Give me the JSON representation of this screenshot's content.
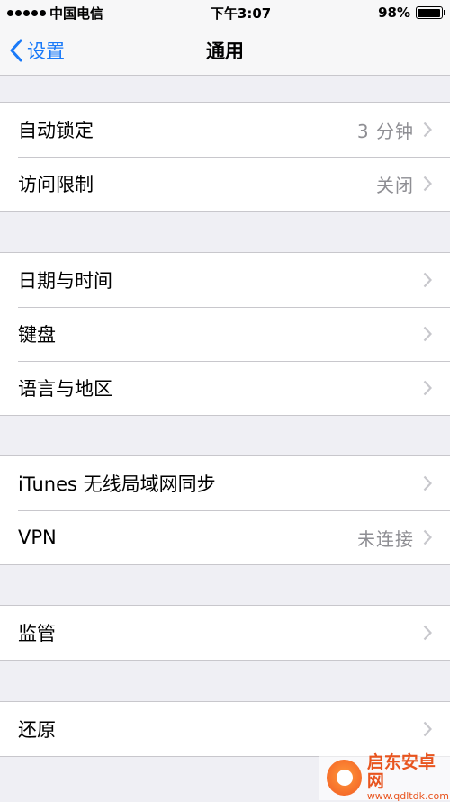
{
  "status": {
    "carrier": "中国电信",
    "time": "下午3:07",
    "battery": "98%",
    "battery_level": 0.98
  },
  "nav": {
    "back_label": "设置",
    "title": "通用"
  },
  "groups": [
    {
      "rows": [
        {
          "label": "自动锁定",
          "value": "3 分钟"
        },
        {
          "label": "访问限制",
          "value": "关闭"
        }
      ]
    },
    {
      "rows": [
        {
          "label": "日期与时间",
          "value": ""
        },
        {
          "label": "键盘",
          "value": ""
        },
        {
          "label": "语言与地区",
          "value": ""
        }
      ]
    },
    {
      "rows": [
        {
          "label": "iTunes 无线局域网同步",
          "value": ""
        },
        {
          "label": "VPN",
          "value": "未连接"
        }
      ]
    },
    {
      "rows": [
        {
          "label": "监管",
          "value": ""
        }
      ]
    },
    {
      "rows": [
        {
          "label": "还原",
          "value": ""
        }
      ]
    }
  ],
  "watermark": {
    "name": "启东安卓网",
    "url": "www.qdltdk.com"
  },
  "colors": {
    "accent": "#1a7af8",
    "background": "#efeff4",
    "secondary_text": "#8e8e93"
  }
}
